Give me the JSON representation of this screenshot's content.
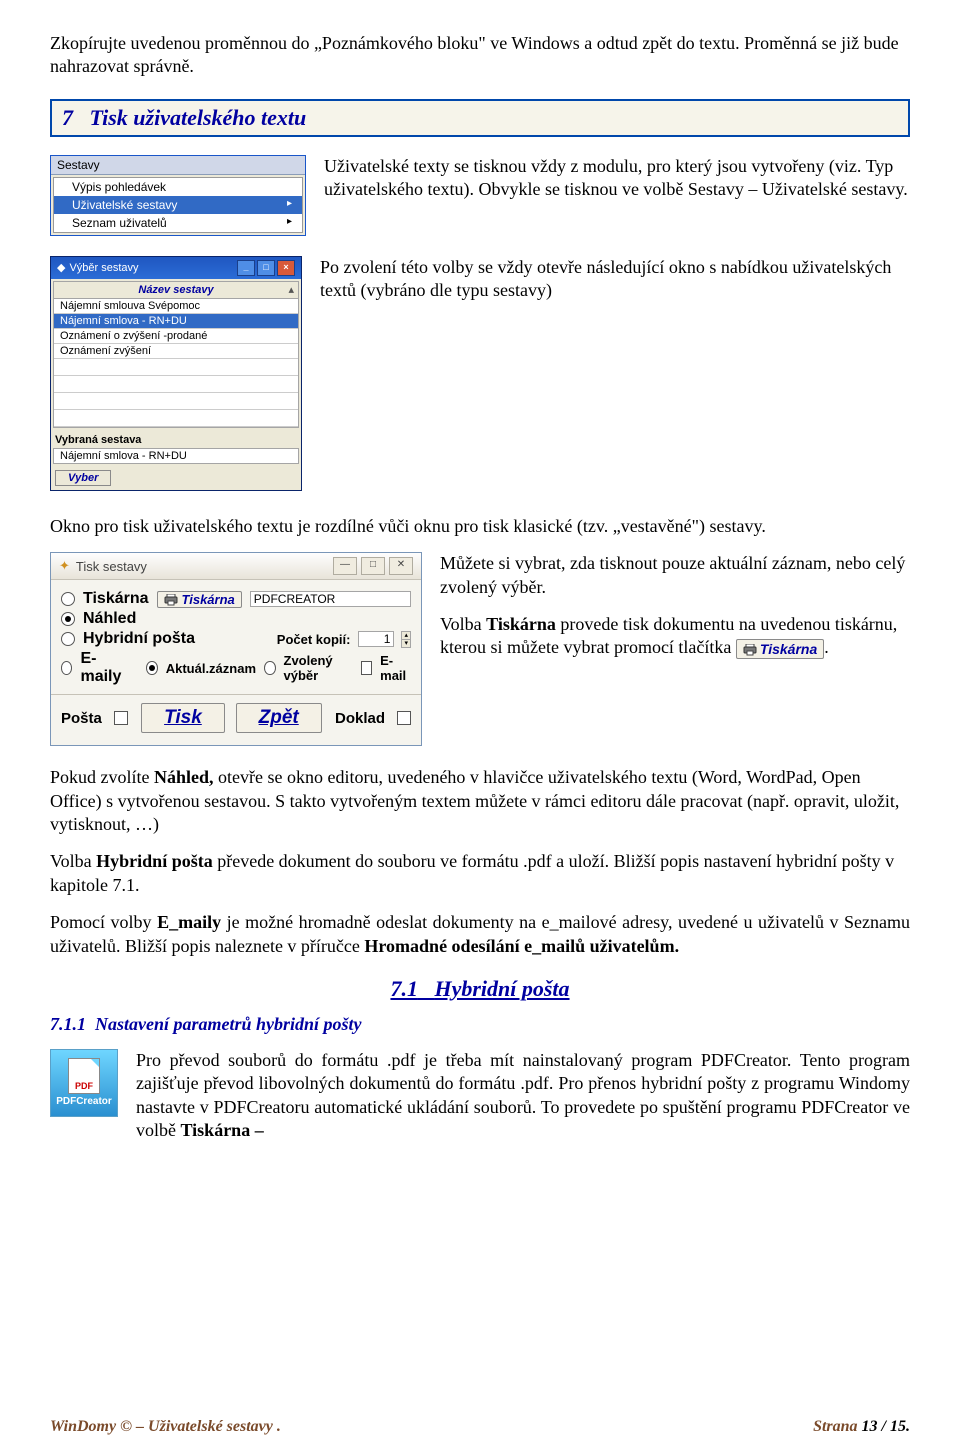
{
  "intro": {
    "p1": "Zkopírujte uvedenou proměnnou do „Poznámkového bloku\" ve Windows a odtud zpět do textu. Proměnná se již bude nahrazovat správně."
  },
  "heading7": {
    "num": "7",
    "title": "Tisk uživatelského textu"
  },
  "sestavy_menu": {
    "tab": "Sestavy",
    "items": [
      "Výpis pohledávek",
      "Uživatelské sestavy",
      "Seznam uživatelů"
    ]
  },
  "para_after_heading7": "Uživatelské texty se tisknou vždy z modulu, pro který jsou vytvořeny (viz. Typ uživatelského textu). Obvykle se tisknou ve volbě Sestavy – Uživatelské sestavy.",
  "vyber_window": {
    "title": "Výběr sestavy",
    "grid_header": "Název sestavy",
    "rows": [
      "Nájemní smlouva Svépomoc",
      "Nájemní smlova - RN+DU",
      "Oznámení o zvýšení -prodané",
      "Oznámení zvýšení"
    ],
    "selected_index": 1,
    "vybrana_label": "Vybraná sestava",
    "vybrana_value": "Nájemní smlova - RN+DU",
    "button": "Vyber"
  },
  "para_after_vyber": "Po zvolení této volby se vždy otevře následující okno s nabídkou uživatelských textů (vybráno dle typu sestavy)",
  "para_okno": "Okno pro tisk uživatelského textu je rozdílné vůči oknu pro tisk klasické (tzv. „vestavěné\") sestavy.",
  "tisk_dialog": {
    "title": "Tisk sestavy",
    "opt_tiskarna": "Tiskárna",
    "btn_tiskarna": "Tiskárna",
    "printer_name": "PDFCREATOR",
    "opt_nahled": "Náhled",
    "opt_hybrid": "Hybridní pošta",
    "kopii_label": "Počet kopií:",
    "kopii_value": "1",
    "opt_emaily": "E-maily",
    "opt_aktual": "Aktuál.záznam",
    "opt_zvoleny": "Zvolený výběr",
    "chk_email": "E-mail",
    "posta_label": "Pošta",
    "btn_tisk": "Tisk",
    "btn_zpet": "Zpět",
    "doklad_label": "Doklad"
  },
  "side_para1": "Můžete si vybrat, zda tisknout pouze aktuální záznam, nebo celý zvolený výběr.",
  "side_para2_a": "Volba ",
  "side_para2_bold": "Tiskárna",
  "side_para2_b": " provede tisk dokumentu na uvedenou tiskárnu, kterou si můžete vybrat promocí tlačítka ",
  "inline_btn_tiskarna": "Tiskárna",
  "side_para2_c": ".",
  "para_nahled": "Pokud zvolíte Náhled, otevře se okno editoru, uvedeného v hlavičce uživatelského textu (Word, WordPad, Open Office) s vytvořenou sestavou. S takto vytvořeným textem můžete v rámci editoru dále pracovat (např. opravit, uložit, vytisknout, …)",
  "para_hybrid": "Volba Hybridní pošta převede dokument do souboru ve formátu .pdf a uloží. Bližší popis nastavení hybridní pošty v kapitole 7.1.",
  "para_emaily": "Pomocí volby E_maily je možné hromadně odeslat dokumenty na e_mailové adresy, uvedené u uživatelů v Seznamu uživatelů. Bližší popis naleznete v příručce Hromadné odesílání e_mailů uživatelům.",
  "heading71": {
    "num": "7.1",
    "title": "Hybridní pošta"
  },
  "heading711": {
    "num": "7.1.1",
    "title": "Nastavení parametrů hybridní pošty"
  },
  "pdfcreator_label": "PDFCreator",
  "para_pdfcreator": "Pro převod souborů do formátu .pdf je třeba mít nainstalovaný program PDFCreator. Tento program zajišťuje převod libovolných dokumentů do formátu .pdf. Pro přenos hybridní pošty z programu Windomy nastavte v PDFCreatoru automatické ukládání souborů. To provedete po spuštění programu PDFCreator ve volbě Tiskárna –",
  "footer": {
    "left": "WinDomy ©  –  Uživatelské sestavy .",
    "right_a": "Strana ",
    "right_b": "13 / 15."
  }
}
